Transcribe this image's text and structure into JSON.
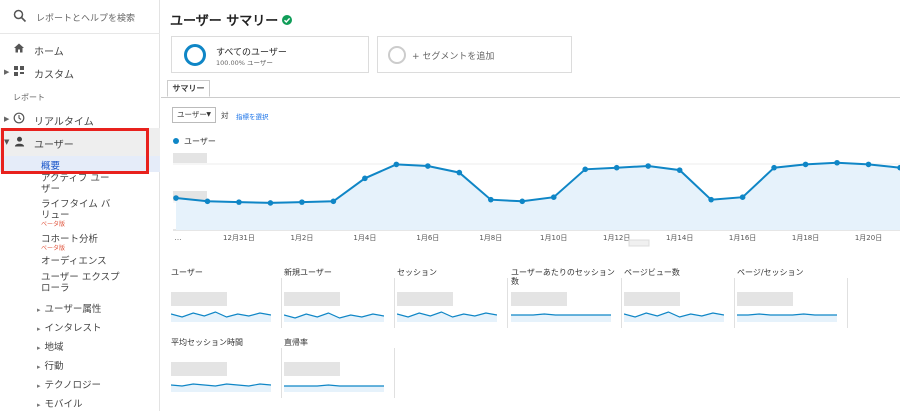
{
  "sidebar": {
    "search_placeholder": "レポートとヘルプを検索",
    "home": "ホーム",
    "custom": "カスタム",
    "reports_label": "レポート",
    "realtime": "リアルタイム",
    "users": "ユーザー",
    "sub_items": [
      {
        "label": "概要",
        "beta": ""
      },
      {
        "label": "アクティブ ユーザー",
        "beta": ""
      },
      {
        "label": "ライフタイム バリュー",
        "beta": "ベータ版"
      },
      {
        "label": "コホート分析",
        "beta": "ベータ版"
      },
      {
        "label": "オーディエンス",
        "beta": ""
      },
      {
        "label": "ユーザー エクスプローラ",
        "beta": ""
      }
    ],
    "groups": [
      "ユーザー属性",
      "インタレスト",
      "地域",
      "行動",
      "テクノロジー",
      "モバイル"
    ]
  },
  "main": {
    "title": "ユーザー サマリー",
    "segments": [
      {
        "name": "すべてのユーザー",
        "detail": "100.00% ユーザー"
      },
      {
        "name": "+ セグメントを追加",
        "detail": ""
      }
    ],
    "tab": "サマリー",
    "metric_selector": "ユーザー",
    "vs_label": "対",
    "select_metric": "指標を選択",
    "legend": "ユーザー"
  },
  "colors": {
    "accent": "#0f86c6",
    "fill": "#e6f2fb",
    "highlight": "#e8211d",
    "verified": "#0f9d58"
  },
  "chart_data": {
    "type": "line",
    "series": [
      {
        "name": "ユーザー",
        "values": [
          39,
          35,
          34,
          33,
          34,
          35,
          63,
          80,
          78,
          70,
          37,
          35,
          40,
          74,
          76,
          78,
          73,
          37,
          40,
          76,
          80,
          82,
          80,
          76
        ]
      }
    ],
    "x_tick_labels": [
      "…",
      "12月31日",
      "1月2日",
      "1月4日",
      "1月6日",
      "1月8日",
      "1月10日",
      "1月12日",
      "1月14日",
      "1月16日",
      "1月18日",
      "1月20日"
    ],
    "ylim": [
      0,
      100
    ]
  },
  "metrics": [
    {
      "label": "ユーザー",
      "trend": [
        6,
        3,
        7,
        4,
        8,
        3,
        6,
        4,
        7,
        5
      ]
    },
    {
      "label": "新規ユーザー",
      "trend": [
        5,
        2,
        6,
        3,
        7,
        2,
        5,
        3,
        6,
        4
      ]
    },
    {
      "label": "セッション",
      "trend": [
        6,
        3,
        7,
        4,
        8,
        3,
        6,
        4,
        7,
        5
      ]
    },
    {
      "label": "ユーザーあたりのセッション数",
      "trend": [
        5,
        5,
        5,
        6,
        5,
        5,
        5,
        5,
        5,
        5
      ]
    },
    {
      "label": "ページビュー数",
      "trend": [
        6,
        3,
        7,
        4,
        8,
        3,
        6,
        4,
        7,
        5
      ]
    },
    {
      "label": "ページ/セッション",
      "trend": [
        5,
        5,
        6,
        5,
        5,
        5,
        6,
        5,
        5,
        5
      ]
    },
    {
      "label": "平均セッション時間",
      "trend": [
        5,
        4,
        6,
        5,
        4,
        6,
        5,
        4,
        6,
        5
      ]
    },
    {
      "label": "直帰率",
      "trend": [
        4,
        4,
        4,
        4,
        5,
        4,
        4,
        4,
        4,
        4
      ]
    }
  ]
}
